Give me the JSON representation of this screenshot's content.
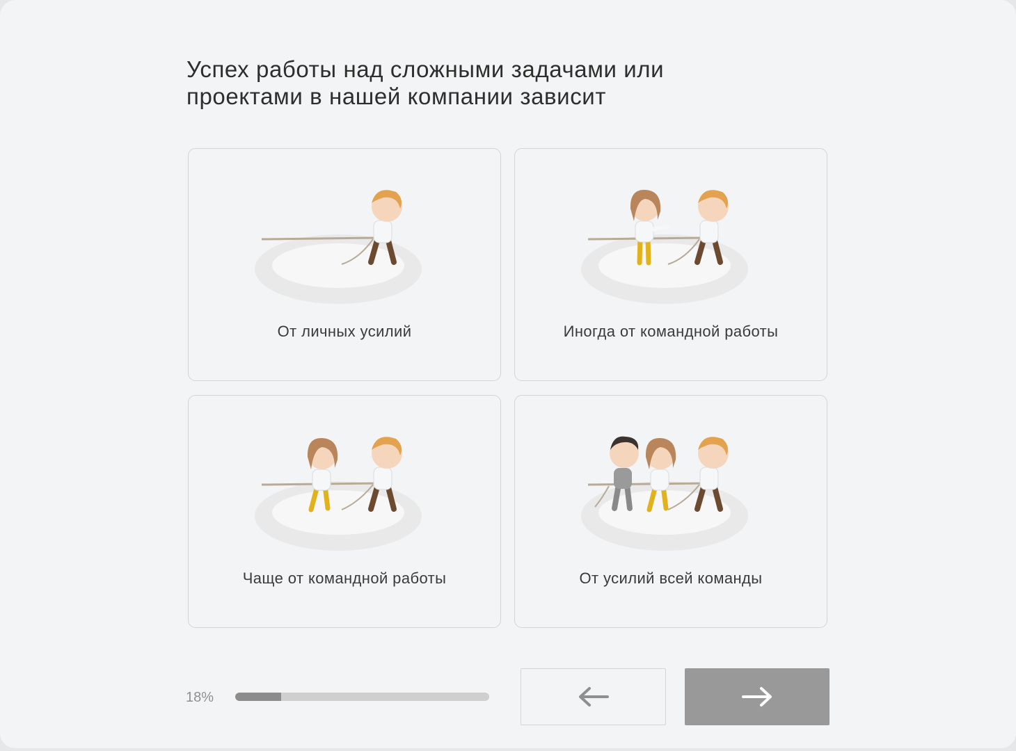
{
  "question": {
    "line1": "Успех работы над сложными задачами или",
    "line2": "проектами в нашей компании зависит"
  },
  "options": [
    {
      "label": "От личных усилий",
      "people": 1
    },
    {
      "label": "Иногда от командной работы",
      "people": 2
    },
    {
      "label": "Чаще от командной работы",
      "people": 2
    },
    {
      "label": "От усилий всей команды",
      "people": 3
    }
  ],
  "progress": {
    "text": "18%",
    "value": 0.18
  },
  "nav": {
    "back_icon": "arrow-left-icon",
    "next_icon": "arrow-right-icon"
  },
  "colors": {
    "panel": "#f3f4f5",
    "next_button": "#999999",
    "progress_fill": "#8c8c8c"
  }
}
